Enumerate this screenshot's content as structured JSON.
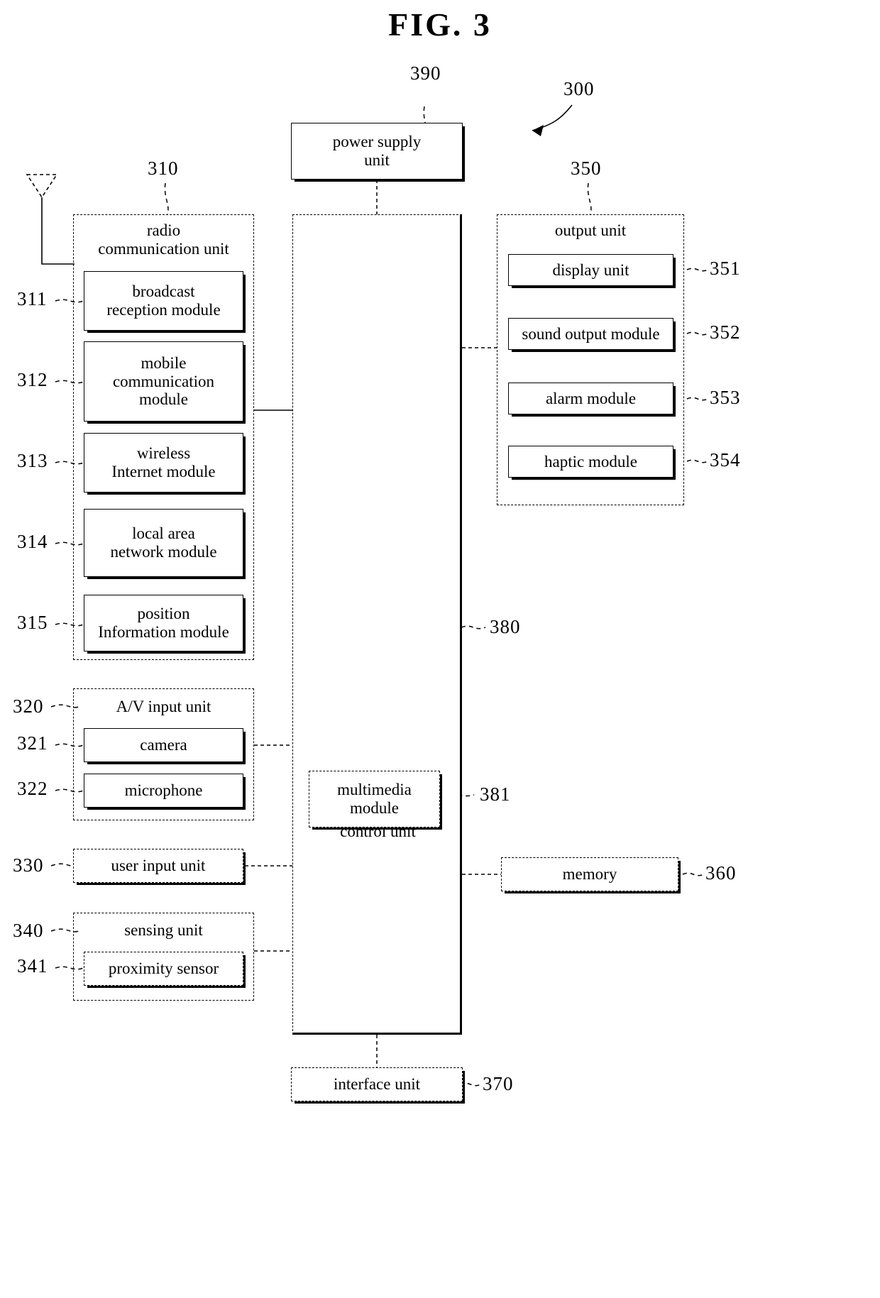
{
  "figure": {
    "title": "FIG. 3",
    "system_ref": "300"
  },
  "power_supply": {
    "label": "power supply\nunit",
    "line1": "power supply",
    "line2": "unit",
    "ref": "390"
  },
  "radio_unit": {
    "group_label_line1": "radio",
    "group_label_line2": "communication unit",
    "ref": "310",
    "modules": [
      {
        "ref": "311",
        "line1": "broadcast",
        "line2": "reception module"
      },
      {
        "ref": "312",
        "line1": "mobile",
        "line2": "communication",
        "line3": "module"
      },
      {
        "ref": "313",
        "line1": "wireless",
        "line2": "Internet module"
      },
      {
        "ref": "314",
        "line1": "local area",
        "line2": "network module"
      },
      {
        "ref": "315",
        "line1": "position",
        "line2": "Information module"
      }
    ]
  },
  "av_input_unit": {
    "group_label": "A/V input unit",
    "ref": "320",
    "modules": [
      {
        "ref": "321",
        "label": "camera"
      },
      {
        "ref": "322",
        "label": "microphone"
      }
    ]
  },
  "user_input_unit": {
    "label": "user input unit",
    "ref": "330"
  },
  "sensing_unit": {
    "group_label": "sensing unit",
    "ref": "340",
    "modules": [
      {
        "ref": "341",
        "label": "proximity sensor"
      }
    ]
  },
  "control_unit": {
    "label": "control unit",
    "ref": "380",
    "multimedia_module": {
      "line1": "multimedia",
      "line2": "module",
      "ref": "381"
    }
  },
  "output_unit": {
    "group_label": "output unit",
    "ref": "350",
    "modules": [
      {
        "ref": "351",
        "label": "display unit"
      },
      {
        "ref": "352",
        "label": "sound output module"
      },
      {
        "ref": "353",
        "label": "alarm module"
      },
      {
        "ref": "354",
        "label": "haptic module"
      }
    ]
  },
  "memory": {
    "label": "memory",
    "ref": "360"
  },
  "interface_unit": {
    "label": "interface unit",
    "ref": "370"
  },
  "antenna": {
    "name": "antenna-symbol"
  },
  "colors": {
    "line": "#000000",
    "background": "#ffffff"
  }
}
